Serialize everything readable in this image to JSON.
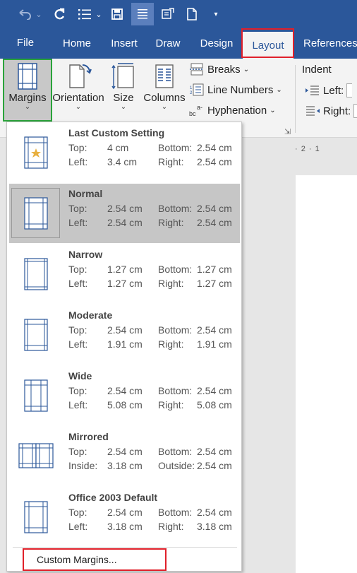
{
  "qat": {
    "undo_icon": "undo-icon",
    "redo_icon": "redo-icon",
    "list_icon": "bullet-list-icon",
    "save_icon": "save-icon",
    "draw_icon": "draw-table-icon",
    "new_icon": "new-doc-icon"
  },
  "tabs": {
    "file": "File",
    "home": "Home",
    "insert": "Insert",
    "draw": "Draw",
    "design": "Design",
    "layout": "Layout",
    "references": "References"
  },
  "ribbon": {
    "margins": "Margins",
    "orientation": "Orientation",
    "size": "Size",
    "columns": "Columns",
    "breaks": "Breaks",
    "line_numbers": "Line Numbers",
    "hyphenation": "Hyphenation",
    "indent": "Indent",
    "left": "Left:",
    "right": "Right:"
  },
  "ruler": "· 2 · 1",
  "margins_menu": {
    "items": [
      {
        "name": "Last Custom Setting",
        "l1": "Top:",
        "v1": "4 cm",
        "l2": "Bottom:",
        "v2": "2.54 cm",
        "l3": "Left:",
        "v3": "3.4 cm",
        "l4": "Right:",
        "v4": "2.54 cm"
      },
      {
        "name": "Normal",
        "l1": "Top:",
        "v1": "2.54 cm",
        "l2": "Bottom:",
        "v2": "2.54 cm",
        "l3": "Left:",
        "v3": "2.54 cm",
        "l4": "Right:",
        "v4": "2.54 cm"
      },
      {
        "name": "Narrow",
        "l1": "Top:",
        "v1": "1.27 cm",
        "l2": "Bottom:",
        "v2": "1.27 cm",
        "l3": "Left:",
        "v3": "1.27 cm",
        "l4": "Right:",
        "v4": "1.27 cm"
      },
      {
        "name": "Moderate",
        "l1": "Top:",
        "v1": "2.54 cm",
        "l2": "Bottom:",
        "v2": "2.54 cm",
        "l3": "Left:",
        "v3": "1.91 cm",
        "l4": "Right:",
        "v4": "1.91 cm"
      },
      {
        "name": "Wide",
        "l1": "Top:",
        "v1": "2.54 cm",
        "l2": "Bottom:",
        "v2": "2.54 cm",
        "l3": "Left:",
        "v3": "5.08 cm",
        "l4": "Right:",
        "v4": "5.08 cm"
      },
      {
        "name": "Mirrored",
        "l1": "Top:",
        "v1": "2.54 cm",
        "l2": "Bottom:",
        "v2": "2.54 cm",
        "l3": "Inside:",
        "v3": "3.18 cm",
        "l4": "Outside:",
        "v4": "2.54 cm"
      },
      {
        "name": "Office 2003 Default",
        "l1": "Top:",
        "v1": "2.54 cm",
        "l2": "Bottom:",
        "v2": "2.54 cm",
        "l3": "Left:",
        "v3": "3.18 cm",
        "l4": "Right:",
        "v4": "3.18 cm"
      }
    ],
    "selected": "Normal",
    "custom": "Custom Margins..."
  },
  "colors": {
    "word_blue": "#2b579a",
    "highlight_red": "#e0202a",
    "highlight_green": "#2aa33a",
    "selected_gray": "#c6c6c6"
  }
}
